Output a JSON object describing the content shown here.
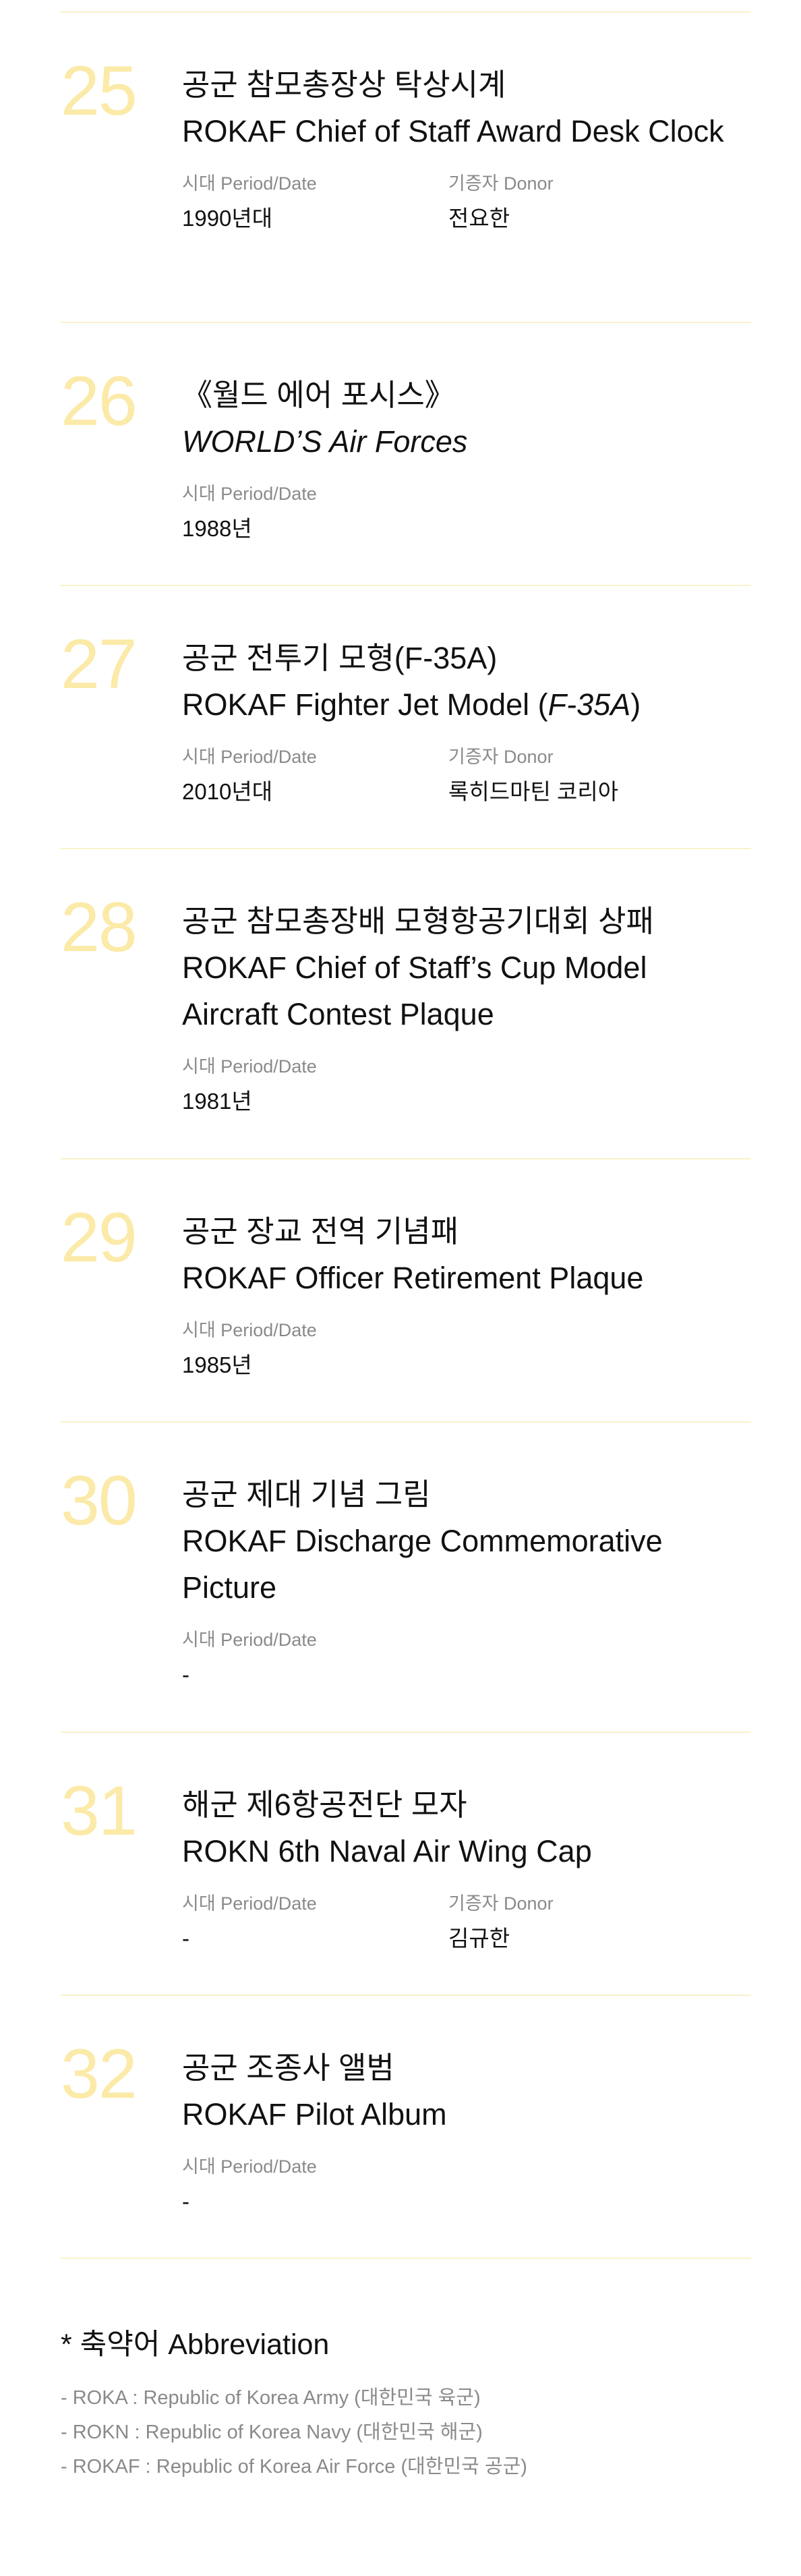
{
  "items": [
    {
      "number": "25",
      "title_ko": "공군 참모총장상 탁상시계",
      "title_en": "ROKAF Chief of Staff Award Desk Clock",
      "period_label": "시대 Period/Date",
      "period_value": "1990년대",
      "donor_label": "기증자 Donor",
      "donor_value": "전요한"
    },
    {
      "number": "26",
      "title_ko": "《월드 에어 포시스》",
      "title_en": "WORLD’S Air Forces",
      "period_label": "시대 Period/Date",
      "period_value": "1988년"
    },
    {
      "number": "27",
      "title_ko": "공군 전투기 모형(F-35A)",
      "title_en_pre": "ROKAF Fighter Jet Model (",
      "title_en_italic": "F-35A",
      "title_en_post": ")",
      "period_label": "시대 Period/Date",
      "period_value": "2010년대",
      "donor_label": "기증자 Donor",
      "donor_value": "록히드마틴 코리아"
    },
    {
      "number": "28",
      "title_ko": "공군 참모총장배 모형항공기대회 상패",
      "title_en": "ROKAF Chief of Staff’s Cup Model Aircraft Contest Plaque",
      "period_label": "시대 Period/Date",
      "period_value": "1981년"
    },
    {
      "number": "29",
      "title_ko": "공군 장교 전역 기념패",
      "title_en": "ROKAF Officer Retirement Plaque",
      "period_label": "시대 Period/Date",
      "period_value": "1985년"
    },
    {
      "number": "30",
      "title_ko": "공군 제대 기념 그림",
      "title_en": "ROKAF Discharge Commemorative Picture",
      "period_label": "시대 Period/Date",
      "period_value": "-"
    },
    {
      "number": "31",
      "title_ko": "해군 제6항공전단 모자",
      "title_en": "ROKN 6th Naval Air Wing Cap",
      "period_label": "시대 Period/Date",
      "period_value": "-",
      "donor_label": "기증자 Donor",
      "donor_value": "김규한"
    },
    {
      "number": "32",
      "title_ko": "공군 조종사 앨범",
      "title_en": "ROKAF Pilot Album",
      "period_label": "시대 Period/Date",
      "period_value": "-"
    }
  ],
  "abbreviation": {
    "title": "* 축약어 Abbreviation",
    "lines": [
      "- ROKA : Republic of Korea Army (대한민국 육군)",
      "- ROKN : Republic of Korea Navy (대한민국 해군)",
      "- ROKAF : Republic of Korea Air Force (대한민국 공군)"
    ]
  },
  "colors": {
    "number": "#fbeaa8",
    "rule": "#fbf1c9",
    "label": "#8a8a8a",
    "text": "#111111"
  }
}
